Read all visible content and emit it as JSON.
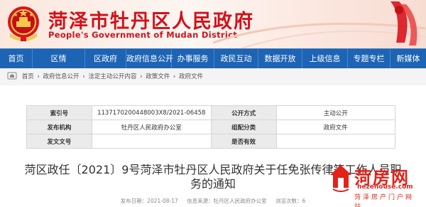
{
  "header": {
    "title": "菏泽市牡丹区人民政府",
    "subtitle": "People's Government of Mudan District",
    "brand_color": "#d1121b"
  },
  "nav": {
    "items": [
      {
        "label": "首页"
      },
      {
        "label": "区情"
      },
      {
        "label": "区政府"
      },
      {
        "label": "政府信息公开"
      },
      {
        "label": "办事服务"
      },
      {
        "label": "政民互动"
      },
      {
        "label": "数据开放"
      },
      {
        "label": "上级信息"
      },
      {
        "label": "专题专栏"
      },
      {
        "label": "新媒体"
      }
    ],
    "bg_color": "#1d64b4"
  },
  "breadcrumb": {
    "items": [
      "首页",
      "政府信息公开",
      "法定主动公开内容",
      "政策文件",
      "政府文件"
    ],
    "separator": "›"
  },
  "info_table": {
    "index_label": "索引号",
    "index_value": "113717020044800​3X8/2021-06458",
    "disclosure_label": "公开方式",
    "disclosure_value": "主动公开",
    "issuer_label": "发布机构",
    "issuer_value": "牡丹区人民政府办公室",
    "category_label": "组配分类",
    "category_value": "政府文件",
    "doc_no_label": "发文文号",
    "doc_no_value": "",
    "validity_label": "是否有效",
    "validity_value": ""
  },
  "document": {
    "title": "菏区政任〔2021〕9号菏泽市牡丹区人民政府关于任免张传律等工作人员职务的通知",
    "publish_date": "发布日期：2021-08-17",
    "source": "信息来源：牡丹区人民政府办公室",
    "views": "浏览次数：6"
  },
  "watermark": {
    "logo": "菏房网",
    "url": "hezehouse.com",
    "tagline": "菏泽房产门户网站"
  }
}
